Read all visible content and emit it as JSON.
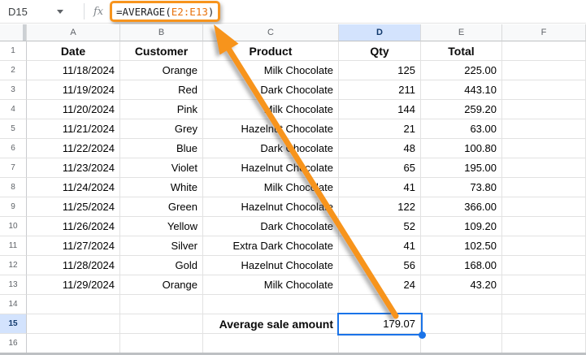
{
  "formula_bar": {
    "name_box_value": "D15",
    "fx_label": "fx",
    "formula": {
      "prefix": "=AVERAGE(",
      "range": "E2:E13",
      "suffix": ")"
    }
  },
  "grid": {
    "column_headers": [
      "A",
      "B",
      "C",
      "D",
      "E",
      "F"
    ],
    "active_column": "D",
    "active_row": "15",
    "active_cell": {
      "ref": "D15",
      "value": "179.07"
    },
    "rows": [
      {
        "n": "1",
        "type": "header",
        "cells": {
          "A": "Date",
          "B": "Customer",
          "C": "Product",
          "D": "Qty",
          "E": "Total"
        }
      },
      {
        "n": "2",
        "type": "data",
        "cells": {
          "A": "11/18/2024",
          "B": "Orange",
          "C": "Milk Chocolate",
          "D": "125",
          "E": "225.00"
        }
      },
      {
        "n": "3",
        "type": "data",
        "cells": {
          "A": "11/19/2024",
          "B": "Red",
          "C": "Dark Chocolate",
          "D": "211",
          "E": "443.10"
        }
      },
      {
        "n": "4",
        "type": "data",
        "cells": {
          "A": "11/20/2024",
          "B": "Pink",
          "C": "Milk Chocolate",
          "D": "144",
          "E": "259.20"
        }
      },
      {
        "n": "5",
        "type": "data",
        "cells": {
          "A": "11/21/2024",
          "B": "Grey",
          "C": "Hazelnut Chocolate",
          "D": "21",
          "E": "63.00"
        }
      },
      {
        "n": "6",
        "type": "data",
        "cells": {
          "A": "11/22/2024",
          "B": "Blue",
          "C": "Dark Chocolate",
          "D": "48",
          "E": "100.80"
        }
      },
      {
        "n": "7",
        "type": "data",
        "cells": {
          "A": "11/23/2024",
          "B": "Violet",
          "C": "Hazelnut Chocolate",
          "D": "65",
          "E": "195.00"
        }
      },
      {
        "n": "8",
        "type": "data",
        "cells": {
          "A": "11/24/2024",
          "B": "White",
          "C": "Milk Chocolate",
          "D": "41",
          "E": "73.80"
        }
      },
      {
        "n": "9",
        "type": "data",
        "cells": {
          "A": "11/25/2024",
          "B": "Green",
          "C": "Hazelnut Chocolate",
          "D": "122",
          "E": "366.00"
        }
      },
      {
        "n": "10",
        "type": "data",
        "cells": {
          "A": "11/26/2024",
          "B": "Yellow",
          "C": "Dark Chocolate",
          "D": "52",
          "E": "109.20"
        }
      },
      {
        "n": "11",
        "type": "data",
        "cells": {
          "A": "11/27/2024",
          "B": "Silver",
          "C": "Extra Dark Chocolate",
          "D": "41",
          "E": "102.50"
        }
      },
      {
        "n": "12",
        "type": "data",
        "cells": {
          "A": "11/28/2024",
          "B": "Gold",
          "C": "Hazelnut Chocolate",
          "D": "56",
          "E": "168.00"
        }
      },
      {
        "n": "13",
        "type": "data",
        "cells": {
          "A": "11/29/2024",
          "B": "Orange",
          "C": "Milk Chocolate",
          "D": "24",
          "E": "43.20"
        }
      },
      {
        "n": "14",
        "type": "empty",
        "cells": {}
      },
      {
        "n": "15",
        "type": "summary",
        "cells": {
          "C": "Average sale amount",
          "D": "179.07"
        }
      },
      {
        "n": "16",
        "type": "empty",
        "cells": {}
      }
    ]
  },
  "colors": {
    "annotation_orange": "#f7941d",
    "formula_range_orange": "#e8710a",
    "selection_blue": "#1a73e8",
    "active_header_bg": "#d3e3fd"
  }
}
